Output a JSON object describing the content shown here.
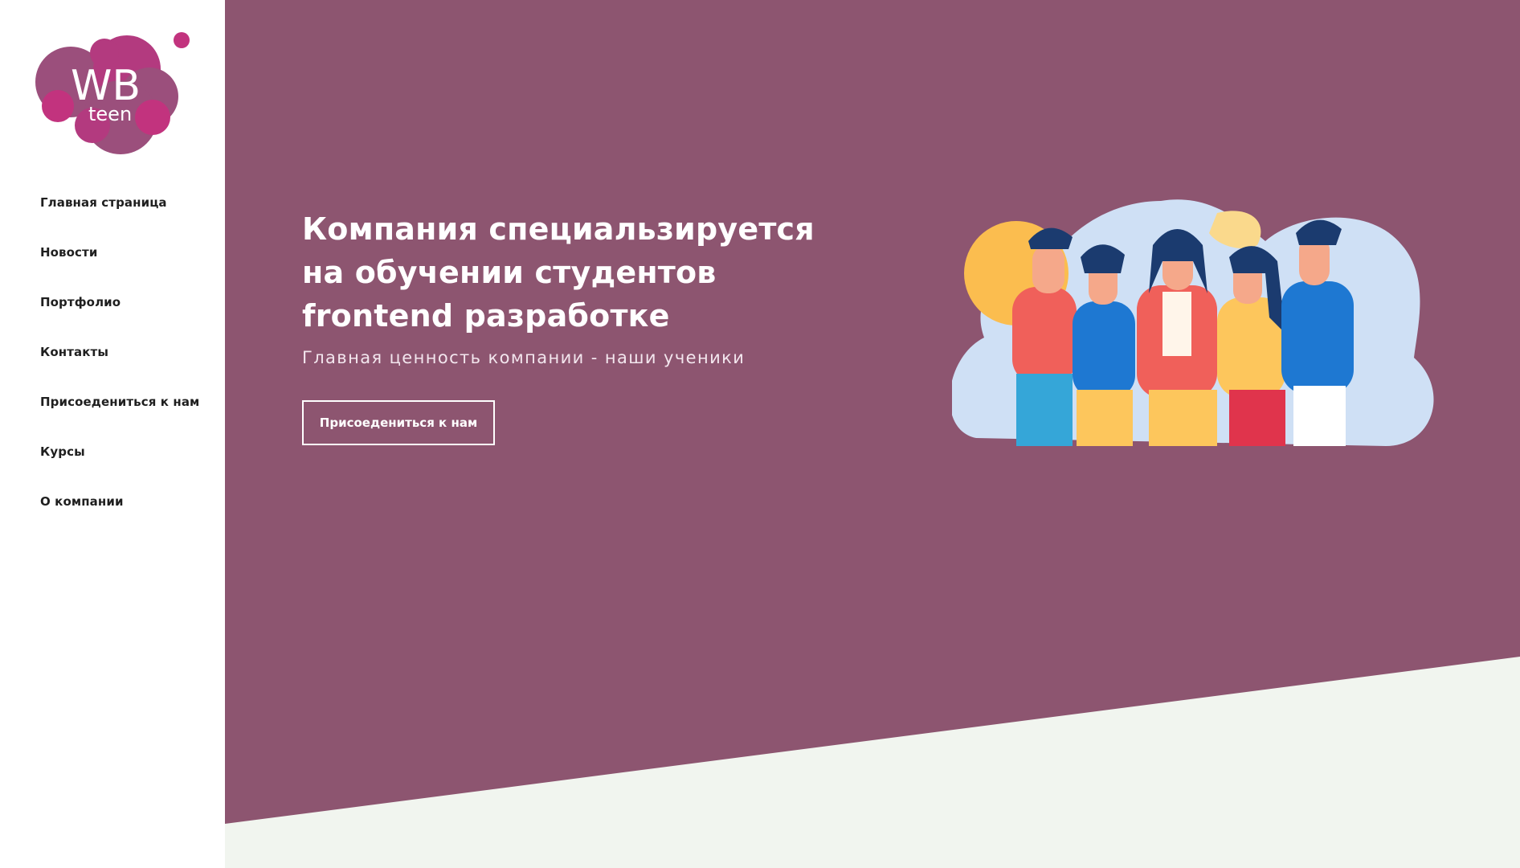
{
  "logo": {
    "brand": "WB",
    "sub": "teen"
  },
  "nav": {
    "items": [
      {
        "label": "Главная страница"
      },
      {
        "label": "Новости"
      },
      {
        "label": "Портфолио"
      },
      {
        "label": "Контакты"
      },
      {
        "label": "Присоедениться к нам"
      },
      {
        "label": "Курсы"
      },
      {
        "label": "О компании"
      }
    ]
  },
  "hero": {
    "title": "Компания специальзируется на обучении студентов frontend разработке",
    "subtitle": "Главная ценность компании - наши ученики",
    "button_label": "Присоедениться к нам"
  },
  "colors": {
    "hero_bg": "#8d5570",
    "bottom_bg": "#f1f5ef",
    "logo_main": "#9b4f7c",
    "logo_accent": "#c2337e"
  }
}
